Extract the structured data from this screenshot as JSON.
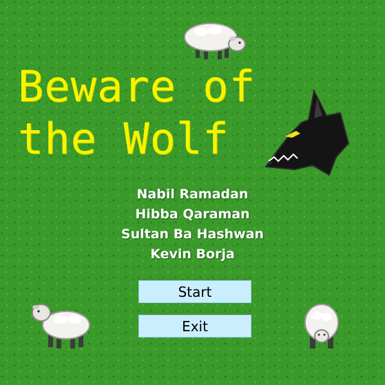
{
  "title": {
    "line1": "Beware of",
    "line2": "the Wolf"
  },
  "credits": [
    "Nabil Ramadan",
    "Hibba Qaraman",
    "Sultan Ba Hashwan",
    "Kevin Borja"
  ],
  "buttons": {
    "start": "Start",
    "exit": "Exit"
  },
  "colors": {
    "grass": "#3a9a2a",
    "title": "#f5f500",
    "button": "#cbeeff",
    "wolf": "#141414",
    "wolf_eye": "#f0e020"
  },
  "icons": [
    "wolf-head-icon",
    "sheep-icon"
  ]
}
